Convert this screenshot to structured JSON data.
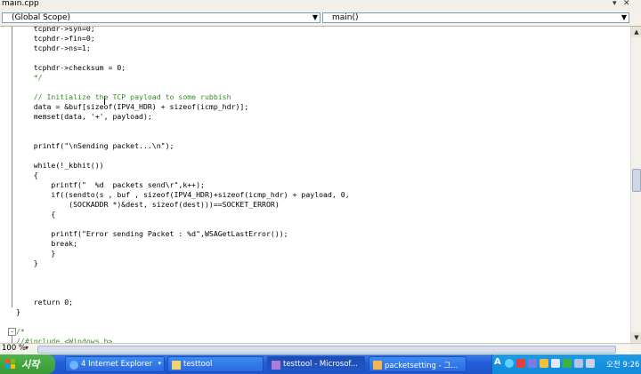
{
  "window": {
    "title": "main.cpp"
  },
  "navbar": {
    "scope": "(Global Scope)",
    "function": "main()"
  },
  "editor": {
    "lines": [
      {
        "text": "    tcphdr->syn=0;",
        "cls": "kw"
      },
      {
        "text": "    tcphdr->fin=0;",
        "cls": "kw"
      },
      {
        "text": "    tcphdr->ns=1;",
        "cls": "kw"
      },
      {
        "text": "",
        "cls": "kw"
      },
      {
        "text": "    tcphdr->checksum = 0;",
        "cls": "kw"
      },
      {
        "text": "    */",
        "cls": "cm"
      },
      {
        "text": "",
        "cls": "kw"
      },
      {
        "text": "    // Initialize the TCP payload to some rubbish",
        "cls": "cm"
      },
      {
        "text": "    data = &buf[sizeof(IPV4_HDR) + sizeof(icmp_hdr)];",
        "cls": "kw"
      },
      {
        "text": "    memset(data, '+', payload);",
        "cls": "kw"
      },
      {
        "text": "",
        "cls": "kw"
      },
      {
        "text": "",
        "cls": "kw"
      },
      {
        "text": "    printf(\"\\nSending packet...\\n\");",
        "cls": "kw"
      },
      {
        "text": "",
        "cls": "kw"
      },
      {
        "text": "    while(!_kbhit())",
        "cls": "kw"
      },
      {
        "text": "    {",
        "cls": "kw"
      },
      {
        "text": "        printf(\"  %d  packets send\\r\",k++);",
        "cls": "kw"
      },
      {
        "text": "        if((sendto(s , buf , sizeof(IPV4_HDR)+sizeof(icmp_hdr) + payload, 0,",
        "cls": "kw"
      },
      {
        "text": "            (SOCKADDR *)&dest, sizeof(dest)))==SOCKET_ERROR)",
        "cls": "kw"
      },
      {
        "text": "        {",
        "cls": "kw"
      },
      {
        "text": "",
        "cls": "kw"
      },
      {
        "text": "        printf(\"Error sending Packet : %d\",WSAGetLastError());",
        "cls": "kw"
      },
      {
        "text": "        break;",
        "cls": "kw"
      },
      {
        "text": "        }",
        "cls": "kw"
      },
      {
        "text": "    }",
        "cls": "kw"
      },
      {
        "text": "",
        "cls": "kw"
      },
      {
        "text": "",
        "cls": "kw"
      },
      {
        "text": "",
        "cls": "kw"
      },
      {
        "text": "    return 0;",
        "cls": "kw"
      },
      {
        "text": "}",
        "cls": "kw"
      },
      {
        "text": "",
        "cls": "kw"
      },
      {
        "text": "/*",
        "cls": "cm"
      },
      {
        "text": "//#include <Windows.h>",
        "cls": "cm"
      }
    ]
  },
  "status": {
    "zoom": "100 %"
  },
  "taskbar": {
    "start_label": "시작",
    "buttons": [
      {
        "label": "4 Internet Explorer",
        "icon_color": "#6fb2ff"
      },
      {
        "label": "testtool",
        "icon_color": "#f3d36b"
      },
      {
        "label": "testtool - Microsof...",
        "icon_color": "#b07ad8",
        "active": true
      },
      {
        "label": "packetsetting - 그...",
        "icon_color": "#f3b84b"
      }
    ],
    "clock": "오전 9:26"
  },
  "colors": {
    "comment": "#3b8a2e",
    "taskbar": "#245edb",
    "start": "#3a9a35"
  }
}
